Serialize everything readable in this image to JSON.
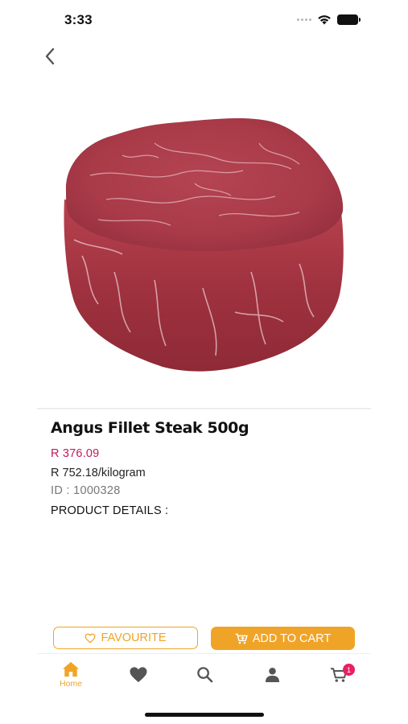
{
  "status_bar": {
    "time": "3:33"
  },
  "product": {
    "title": "Angus Fillet Steak 500g",
    "price": "R 376.09",
    "unit_price": "R 752.18/kilogram",
    "id_label": "ID : 1000328",
    "details_heading": "PRODUCT DETAILS :"
  },
  "actions": {
    "favourite_label": "FAVOURITE",
    "add_to_cart_label": "ADD TO CART"
  },
  "tab_bar": {
    "home_label": "Home",
    "cart_badge": "1",
    "active_tab": "home",
    "tabs": [
      "home-icon",
      "heart-icon",
      "search-icon",
      "person-icon",
      "cart-icon"
    ]
  },
  "colors": {
    "accent": "#f0a427",
    "price": "#c2185b",
    "badge": "#e91e63",
    "inactive_icon": "#555555"
  }
}
